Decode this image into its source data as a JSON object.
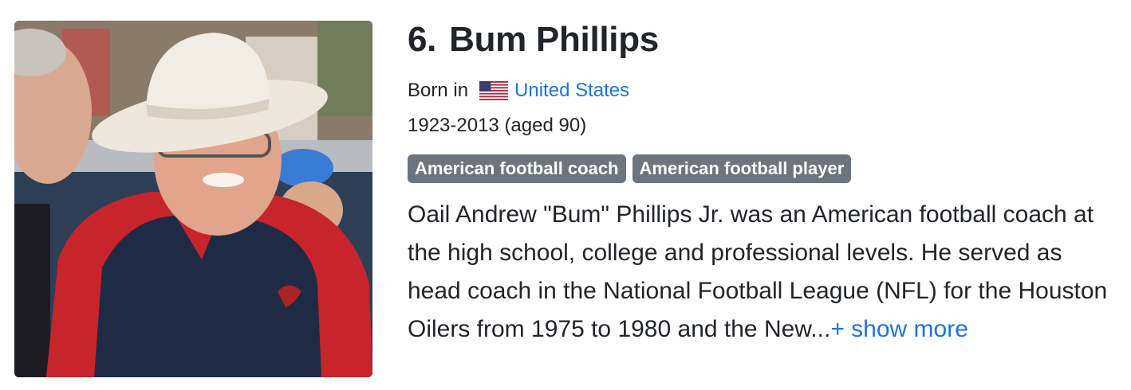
{
  "person": {
    "rank": "6.",
    "name": "Bum Phillips",
    "born_prefix": "Born in",
    "country": "United States",
    "country_flag_icon": "us-flag-icon",
    "lifespan": "1923-2013 (aged 90)",
    "tags": [
      "American football coach",
      "American football player"
    ],
    "description": "Oail Andrew \"Bum\" Phillips Jr. was an American football coach at the high school, college and professional levels. He served as head coach in the National Football League (NFL) for the Houston Oilers from 1975 to 1980 and the New...",
    "show_more_label": "+ show more"
  },
  "colors": {
    "link": "#1a73e8",
    "tag_bg": "#6c757d",
    "text": "#212529"
  }
}
